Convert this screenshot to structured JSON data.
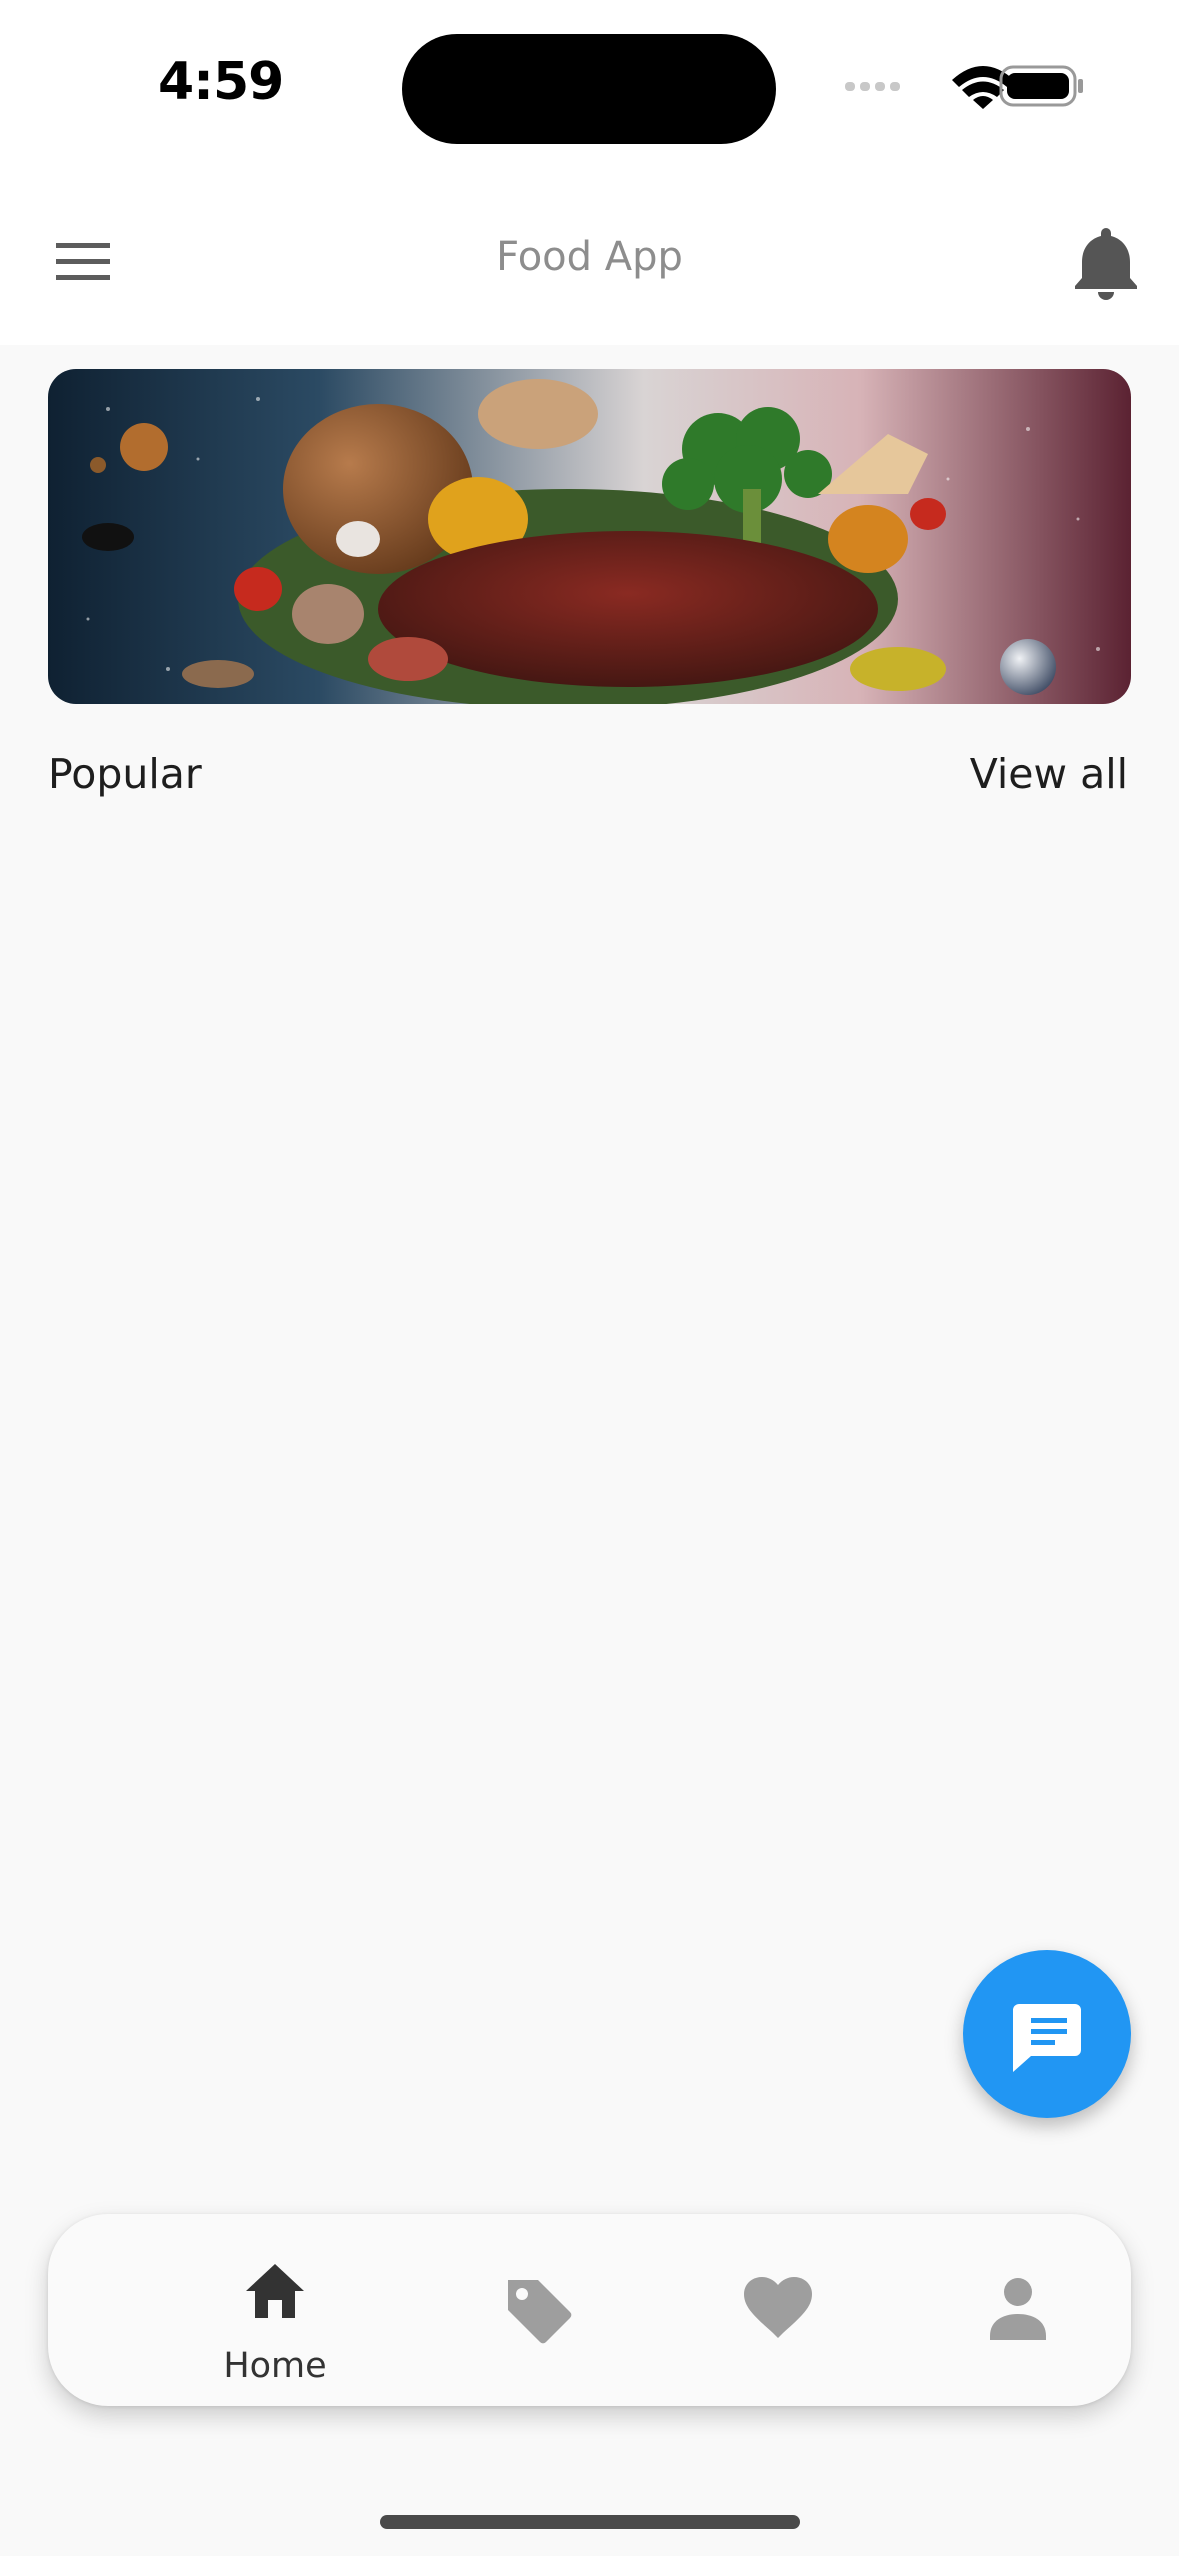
{
  "status_bar": {
    "time": "4:59"
  },
  "app_bar": {
    "title": "Food App"
  },
  "banner": {
    "image": "food-planet-banner"
  },
  "popular": {
    "label": "Popular",
    "view_all": "View all"
  },
  "bottom_nav": {
    "items": [
      {
        "label": "Home",
        "icon": "home-icon",
        "active": true
      },
      {
        "icon": "tag-icon",
        "active": false
      },
      {
        "icon": "heart-icon",
        "active": false
      },
      {
        "icon": "user-icon",
        "active": false
      }
    ]
  },
  "colors": {
    "accent": "#2196f3",
    "title_text": "#8d8d8d",
    "icon_active": "#333333",
    "icon_inactive": "#9e9e9e"
  }
}
